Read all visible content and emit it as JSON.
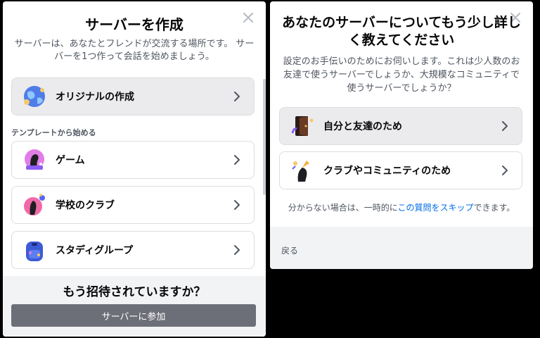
{
  "create": {
    "title": "サーバーを作成",
    "description": "サーバーは、あなたとフレンドが交流する場所です。 サーバーを1つ作って会話を始めましょう。",
    "original": {
      "label": "オリジナルの作成",
      "icon": "globe-icon"
    },
    "template_heading": "テンプレートから始める",
    "templates": [
      {
        "label": "ゲーム",
        "icon": "game-controller-icon"
      },
      {
        "label": "学校のクラブ",
        "icon": "school-club-icon"
      },
      {
        "label": "スタディグループ",
        "icon": "backpack-icon"
      }
    ],
    "footer": {
      "heading": "もう招待されていますか？",
      "join_label": "サーバーに参加"
    }
  },
  "about": {
    "title": "あなたのサーバーについてもう少し詳しく教えてください",
    "description": "設定のお手伝いのためにお伺いします。これは少人数のお友達で使うサーバーでしょうか、大規模なコミュニティで使うサーバーでしょうか？",
    "options": [
      {
        "label": "自分と友達のため",
        "icon": "door-icon"
      },
      {
        "label": "クラブやコミュニティのため",
        "icon": "community-icon"
      }
    ],
    "skip": {
      "prefix": "分からない場合は、一時的に",
      "link": "この質問をスキップ",
      "suffix": "できます。"
    },
    "back_label": "戻る"
  },
  "colors": {
    "accent": "#5865f2",
    "link": "#006ce7",
    "join_button": "#6d6f78"
  }
}
